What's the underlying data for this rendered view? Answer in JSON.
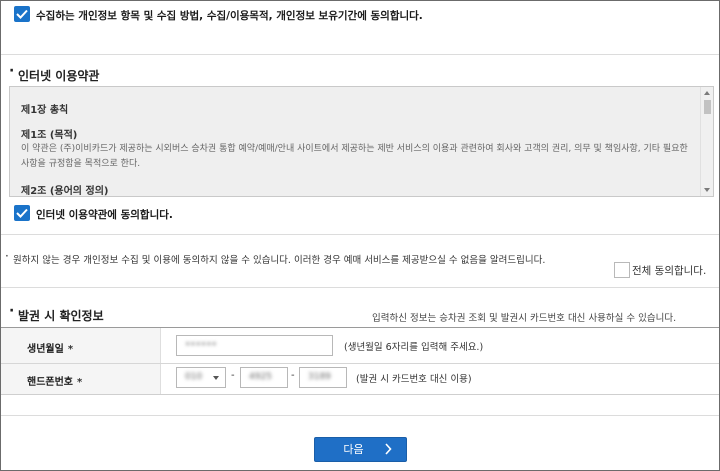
{
  "consent_privacy": {
    "label": "수집하는 개인정보 항목 및 수집 방법, 수집/이용목적, 개인정보 보유기간에 동의합니다.",
    "checked": true
  },
  "terms_section": {
    "title": "인터넷 이용약관",
    "chapter": "제1장 총칙",
    "article1_title": "제1조 (목적)",
    "article1_body": "이 약관은 (주)이비카드가 제공하는 시외버스 승차권 통합 예약/예매/안내 사이트에서 제공하는 제반 서비스의 이용과 관련하여 회사와 고객의 권리, 의무 및 책임사항, 기타 필요한 사항을 규정함을 목적으로 한다.",
    "article2_title": "제2조 (용어의 정의)"
  },
  "consent_terms": {
    "label": "인터넷 이용약관에 동의합니다.",
    "checked": true
  },
  "notice": "원하지 않는 경우 개인정보 수집 및 이용에 동의하지 않을 수 있습니다. 이러한 경우 예매 서비스를 제공받으실 수 없음을 알려드립니다.",
  "agree_all": {
    "label": "전체 동의합니다.",
    "checked": false
  },
  "ticket_info": {
    "title": "발권 시 확인정보",
    "hint": "입력하신 정보는 승차권 조회 및 발권시 카드번호 대신 사용하실 수 있습니다.",
    "birth_label": "생년월일",
    "birth_required": "*",
    "birth_value": "••••••",
    "birth_help": "(생년월일 6자리를 입력해 주세요.)",
    "phone_label": "핸드폰번호",
    "phone_required": "*",
    "phone_prefix": "010",
    "phone_mid": "4925",
    "phone_last": "3189",
    "phone_sep": "-",
    "phone_help": "(발권 시 카드번호 대신 이용)"
  },
  "next_button": {
    "label": "다음",
    "icon": "chevron-right-icon"
  },
  "colors": {
    "accent": "#1f6fc6",
    "checkbox": "#1a73c9"
  }
}
